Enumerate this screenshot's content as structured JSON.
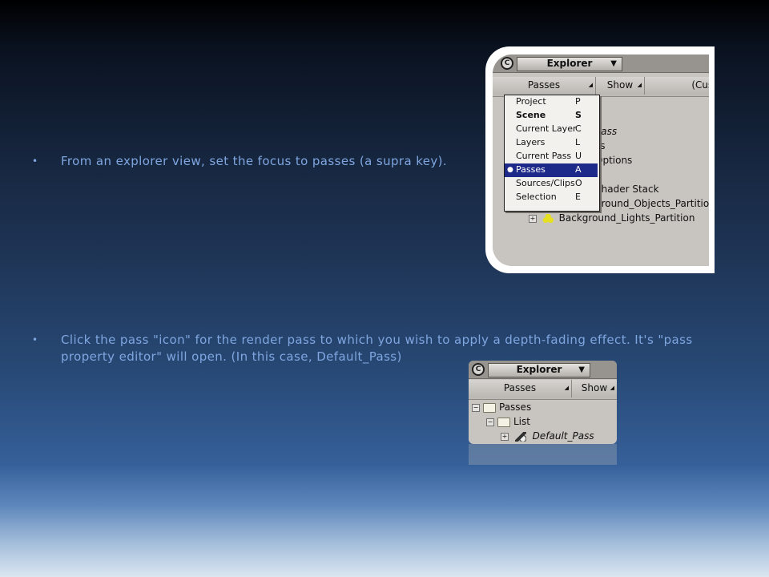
{
  "bullets": [
    {
      "marker": "•",
      "text": "From an explorer view, set the focus to passes (a supra key)."
    },
    {
      "marker": "•",
      "text": "Click the pass \"icon\" for the render pass to which you wish to apply a depth-fading effect. It's \"pass property editor\" will open. (In this case, Default_Pass)"
    }
  ],
  "shot1": {
    "close_glyph": "C",
    "title": "Explorer",
    "title_arrow": "▼",
    "passes_button": "Passes",
    "show_button": "Show",
    "custom_button": "(Cust",
    "corner_glyph": "◢",
    "menu": [
      {
        "label": "Project",
        "key": "P",
        "selected": false,
        "bold": false
      },
      {
        "label": "Scene",
        "key": "S",
        "selected": false,
        "bold": true
      },
      {
        "label": "Current Layer",
        "key": "C",
        "selected": false,
        "bold": false
      },
      {
        "label": "Layers",
        "key": "L",
        "selected": false,
        "bold": false
      },
      {
        "label": "Current Pass",
        "key": "U",
        "selected": false,
        "bold": false
      },
      {
        "label": "Passes",
        "key": "A",
        "selected": true,
        "bold": false
      },
      {
        "label": "Sources/Clips",
        "key": "O",
        "selected": false,
        "bold": false
      },
      {
        "label": "Selection",
        "key": "E",
        "selected": false,
        "bold": false
      }
    ],
    "selected_bullet": "●",
    "tree_partial": [
      "Pass",
      "ss",
      "Options",
      "Shader Stack",
      "ground_Objects_Partition",
      "Background_Lights_Partition"
    ]
  },
  "shot2": {
    "close_glyph": "C",
    "title": "Explorer",
    "title_arrow": "▼",
    "passes_button": "Passes",
    "show_button": "Show",
    "corner_glyph": "◢",
    "tree": [
      {
        "label": "Passes",
        "toggle": "−"
      },
      {
        "label": "List",
        "toggle": "−"
      },
      {
        "label": "Default_Pass",
        "toggle": "+"
      }
    ]
  }
}
